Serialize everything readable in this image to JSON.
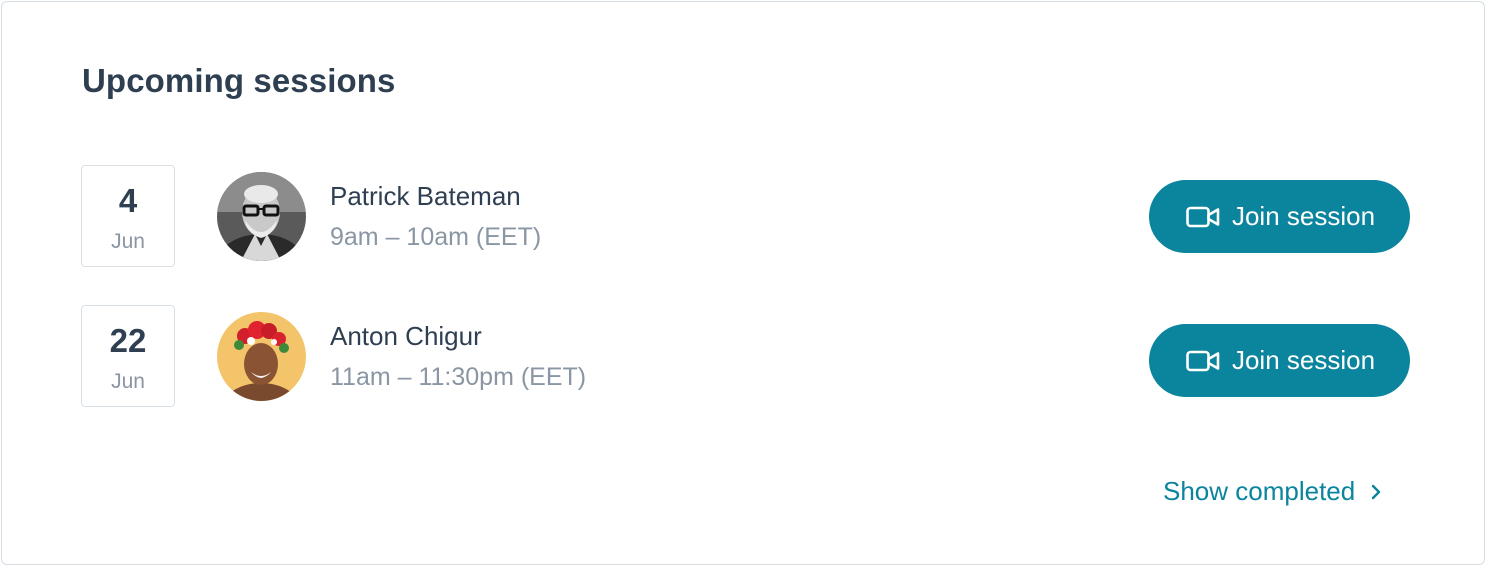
{
  "panel": {
    "title": "Upcoming sessions"
  },
  "sessions": [
    {
      "day": "4",
      "month": "Jun",
      "name": "Patrick Bateman",
      "time": "9am – 10am (EET)",
      "button_label": "Join session",
      "avatar_icon": "avatar-photo-man-glasses"
    },
    {
      "day": "22",
      "month": "Jun",
      "name": "Anton Chigur",
      "time": "11am – 11:30pm (EET)",
      "button_label": "Join session",
      "avatar_icon": "avatar-photo-flower-crown"
    }
  ],
  "footer": {
    "show_completed_label": "Show completed"
  },
  "colors": {
    "accent": "#0b849d",
    "heading": "#2f3f52",
    "muted": "#8a96a3",
    "border": "#d6dee4"
  }
}
